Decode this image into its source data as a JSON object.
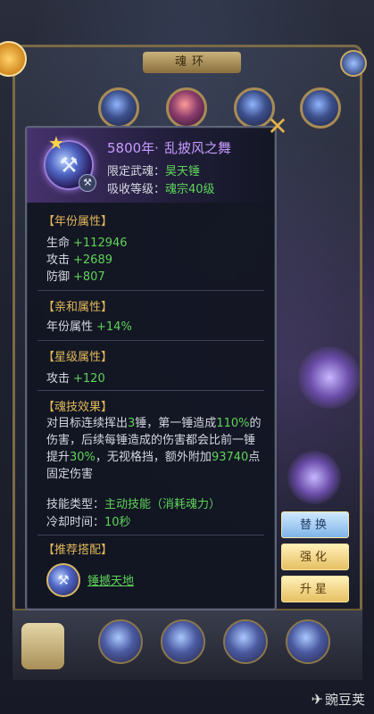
{
  "background": {
    "header_title": "魂环"
  },
  "tooltip": {
    "year_label": "5800年·",
    "name": "乱披风之舞",
    "limit_label": "限定武魂：",
    "limit_value": "昊天锤",
    "absorb_label": "吸收等级：",
    "absorb_value": "魂宗40级",
    "sections": {
      "year_attr": {
        "title": "【年份属性】",
        "rows": [
          {
            "label": "生命",
            "value": "+112946"
          },
          {
            "label": "攻击",
            "value": "+2689"
          },
          {
            "label": "防御",
            "value": "+807"
          }
        ]
      },
      "affinity_attr": {
        "title": "【亲和属性】",
        "rows": [
          {
            "label": "年份属性",
            "value": "+14%"
          }
        ]
      },
      "star_attr": {
        "title": "【星级属性】",
        "rows": [
          {
            "label": "攻击",
            "value": "+120"
          }
        ]
      },
      "skill_effect": {
        "title": "【魂技效果】",
        "p1": "对目标连续挥出",
        "p1_num": "3",
        "p2": "锤，第一锤造成",
        "p2_num": "110%",
        "p3": "的伤害，后续每锤造成的伤害都会比前一锤提升",
        "p3_num": "30%",
        "p4": "，无视格挡，额外附加",
        "p4_num": "93740",
        "p5": "点固定伤害",
        "type_label": "技能类型：",
        "type_value": "主动技能（消耗魂力）",
        "cd_label": "冷却时间：",
        "cd_value": "10秒"
      },
      "recommend": {
        "title": "【推荐搭配】",
        "link": "锤撼天地"
      }
    }
  },
  "actions": {
    "replace": "替换",
    "strengthen": "强化",
    "star_up": "升星"
  },
  "watermark": "豌豆荚"
}
